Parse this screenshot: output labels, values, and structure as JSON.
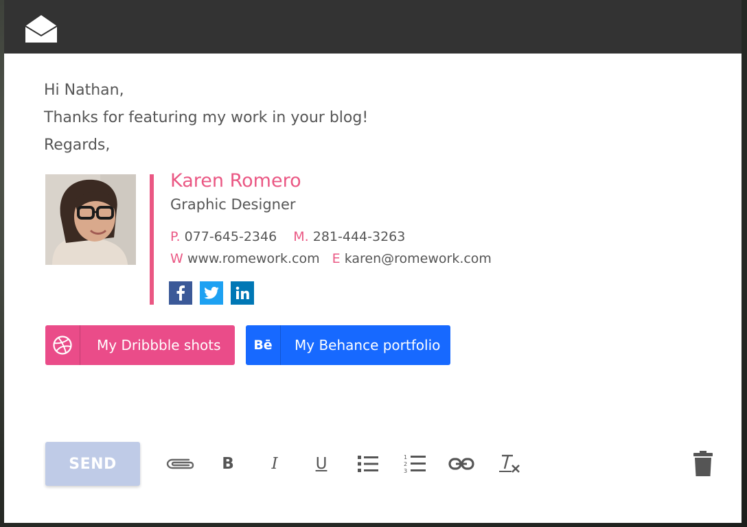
{
  "app": {
    "icon": "envelope-open-icon"
  },
  "message": {
    "lines": [
      "Hi Nathan,",
      "Thanks for featuring my work in your blog!",
      "Regards,"
    ]
  },
  "signature": {
    "name": "Karen Romero",
    "title": "Graphic Designer",
    "phone_label": "P.",
    "phone": "077-645-2346",
    "mobile_label": "M.",
    "mobile": "281-444-3263",
    "web_label": "W",
    "web": "www.romework.com",
    "email_label": "E",
    "email": "karen@romework.com",
    "accent_color": "#ea5783",
    "social": [
      "facebook-icon",
      "twitter-icon",
      "linkedin-icon"
    ]
  },
  "buttons": {
    "dribbble_label": "My Dribbble shots",
    "dribbble_color": "#ea4c89",
    "behance_label": "My Behance portfolio",
    "behance_glyph": "Bē",
    "behance_color": "#1769ff"
  },
  "toolbar": {
    "send_label": "SEND",
    "bold": "B",
    "italic": "I",
    "underline": "U",
    "tools": [
      "attach-icon",
      "bold-icon",
      "italic-icon",
      "underline-icon",
      "bulleted-list-icon",
      "numbered-list-icon",
      "link-icon",
      "clear-formatting-icon",
      "trash-icon"
    ]
  }
}
